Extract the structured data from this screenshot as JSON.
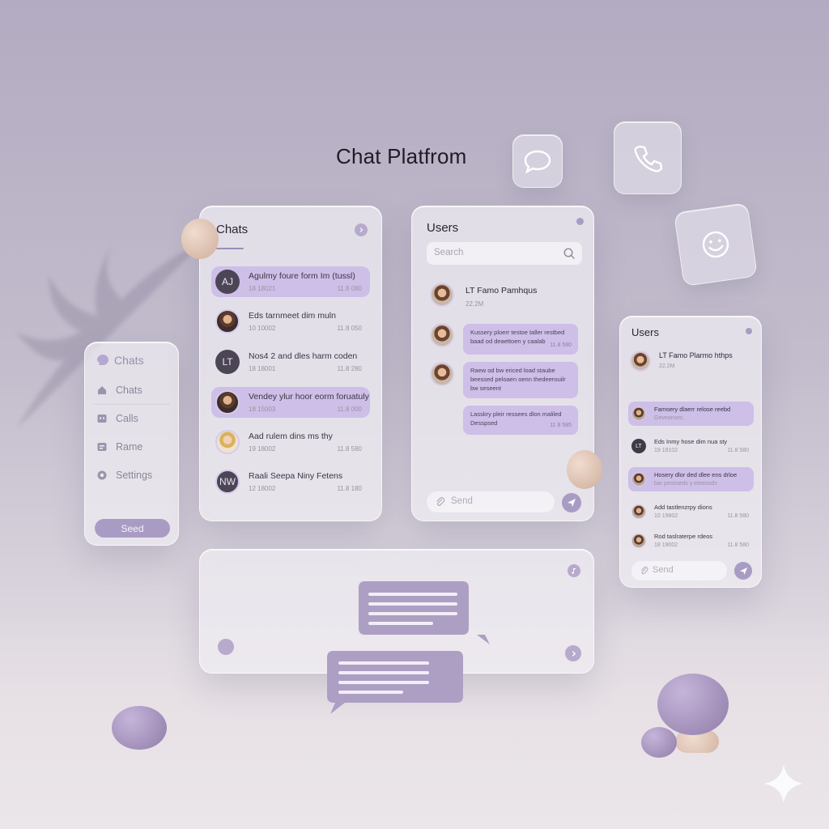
{
  "page": {
    "title": "Chat Platfrom"
  },
  "floating_icons": [
    {
      "name": "chat-bubble-icon"
    },
    {
      "name": "phone-icon"
    },
    {
      "name": "smiley-icon"
    }
  ],
  "sidebar": {
    "header": "Chats",
    "items": [
      {
        "label": "Chats",
        "icon": "home-icon"
      },
      {
        "label": "Calls",
        "icon": "calendar-icon"
      },
      {
        "label": "Rame",
        "icon": "image-icon"
      },
      {
        "label": "Settings",
        "icon": "gear-icon"
      }
    ],
    "button": "Seed"
  },
  "chats_panel": {
    "title": "Chats",
    "rows": [
      {
        "avatar_text": "AJ",
        "name": "Agulmy foure form Im (tussl)",
        "sub": "18 18021",
        "time": "11.8 080",
        "highlighted": true
      },
      {
        "avatar_text": "",
        "name": "Eds tarnmeet dim muln",
        "sub": "10 10002",
        "time": "11.8 050",
        "highlighted": false
      },
      {
        "avatar_text": "LT",
        "name": "Nos4 2 and dles harm coden",
        "sub": "18 18001",
        "time": "11.8 280",
        "highlighted": false
      },
      {
        "avatar_text": "",
        "name": "Vendey ylur hoor eorm foruatuly",
        "sub": "18 15003",
        "time": "11.8 000",
        "highlighted": true
      },
      {
        "avatar_text": "",
        "name": "Aad rulem dins ms thy",
        "sub": "19 18002",
        "time": "11.8 580",
        "highlighted": false
      },
      {
        "avatar_text": "NW",
        "name": "Raali Seepa Niny Fetens",
        "sub": "12 18002",
        "time": "11.8 180",
        "highlighted": false
      }
    ]
  },
  "users_panel": {
    "title": "Users",
    "search_placeholder": "Search",
    "contact": {
      "name": "LT Famo Pamhqus",
      "sub": "22.2M"
    },
    "messages": [
      {
        "text": "Kussery ploerr testoe taller restbed baad od deaettoen y caalab",
        "time": "11.8 580"
      },
      {
        "text": "Raew od bw ericed load staube beessed peloaen oenn thedeerouilr bw seseent",
        "time": ""
      },
      {
        "text": "Lasskry pleir ressees dlon maliled Desspsed",
        "time": "11 8 585"
      }
    ],
    "send_placeholder": "Send"
  },
  "users_panel_2": {
    "title": "Users",
    "contact": {
      "name": "LT Famo Plarmo hthps",
      "sub": "22.2M"
    },
    "rows": [
      {
        "avatar": "photo",
        "name": "Famsery dlaerr relose reebd",
        "sub": "Geveanses.",
        "time": "",
        "highlighted": true
      },
      {
        "avatar": "LT",
        "name": "Eds Inmy hose dim nua sty",
        "sub": "19 19102",
        "time": "11.8 580",
        "highlighted": false
      },
      {
        "avatar": "photo",
        "name": "Hosery dlor ded dlee ens drloe",
        "sub": "bar peosseds y eteeosds",
        "time": "",
        "highlighted": true
      },
      {
        "avatar": "photo",
        "name": "Add tastlenzrpy dions",
        "sub": "10 19802",
        "time": "11.8 580",
        "highlighted": false
      },
      {
        "avatar": "photo",
        "name": "Rod taslraterpe rdeos",
        "sub": "18 19002",
        "time": "11.8 580",
        "highlighted": false
      }
    ],
    "send_placeholder": "Send"
  },
  "colors": {
    "accent": "#a99cc4",
    "highlight": "#cdbfe8",
    "card": "#f0edf3"
  }
}
